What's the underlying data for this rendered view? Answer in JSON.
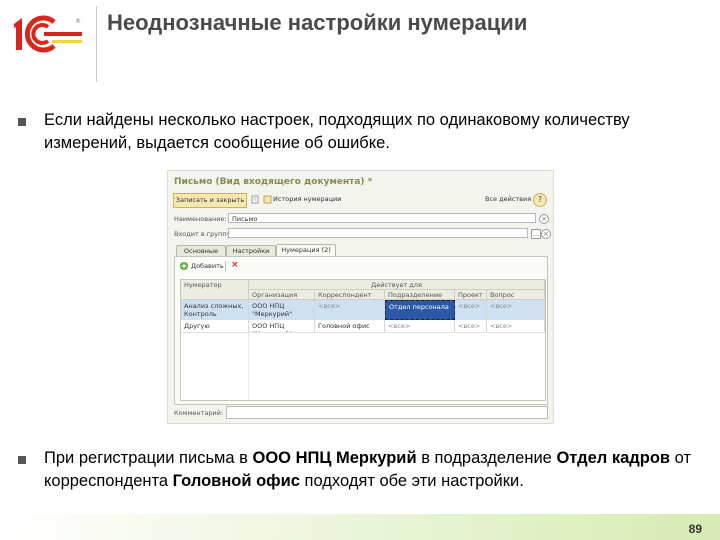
{
  "slide": {
    "logo_text": "1С",
    "title": "Неоднозначные настройки нумерации",
    "bullet1": "Если найдены несколько настроек, подходящих по одинаковому количеству измерений, выдается сообщение об ошибке.",
    "bullet2_parts": {
      "p1": "При регистрации письма в ",
      "b1": "ООО НПЦ Меркурий",
      "p2": " в подразделение ",
      "b2": "Отдел кадров",
      "p3": " от корреспондента ",
      "b3": "Головной офис",
      "p4": " подходят обе эти настройки."
    },
    "page_number": "89"
  },
  "window": {
    "title": "Письмо (Вид входящего документа) *",
    "toolbar": {
      "save_label": "Записать и закрыть",
      "history_label": "История нумерации",
      "all_actions_label": "Все действия ▾",
      "help_label": "?"
    },
    "name_label": "Наименование:",
    "name_value": "Письмо",
    "group_label": "Входит в группу:",
    "group_value": "",
    "tabs": [
      {
        "label": "Основные"
      },
      {
        "label": "Настройки"
      },
      {
        "label": "Нумерация (2)"
      }
    ],
    "panel": {
      "add_label": "Добавить",
      "columns": {
        "numerator": "Нумератор",
        "group_header": "Действует для",
        "organization": "Организация",
        "correspondent": "Корреспондент",
        "department": "Подразделение",
        "project": "Проект",
        "question": "Вопрос"
      },
      "rows": [
        {
          "numerator": "Анализ сложных, Контроль",
          "organization": "ООО НПЦ \"Меркурий\"",
          "correspondent": "<все>",
          "department": "Отдел персонала",
          "project": "<все>",
          "question": "<все>"
        },
        {
          "numerator": "Другую",
          "organization": "ООО НПЦ \"Меркурий\"",
          "correspondent": "Головной офис",
          "department": "<все>",
          "project": "<все>",
          "question": "<все>"
        }
      ]
    },
    "comment_label": "Комментарий:",
    "comment_value": ""
  },
  "colors": {
    "brand_red": "#d7261b",
    "brand_yellow": "#f3d23a",
    "selected_row": "#cfe0f3",
    "selected_cell": "#2c58a8",
    "bottom_gradient": "#d6ebb2"
  }
}
